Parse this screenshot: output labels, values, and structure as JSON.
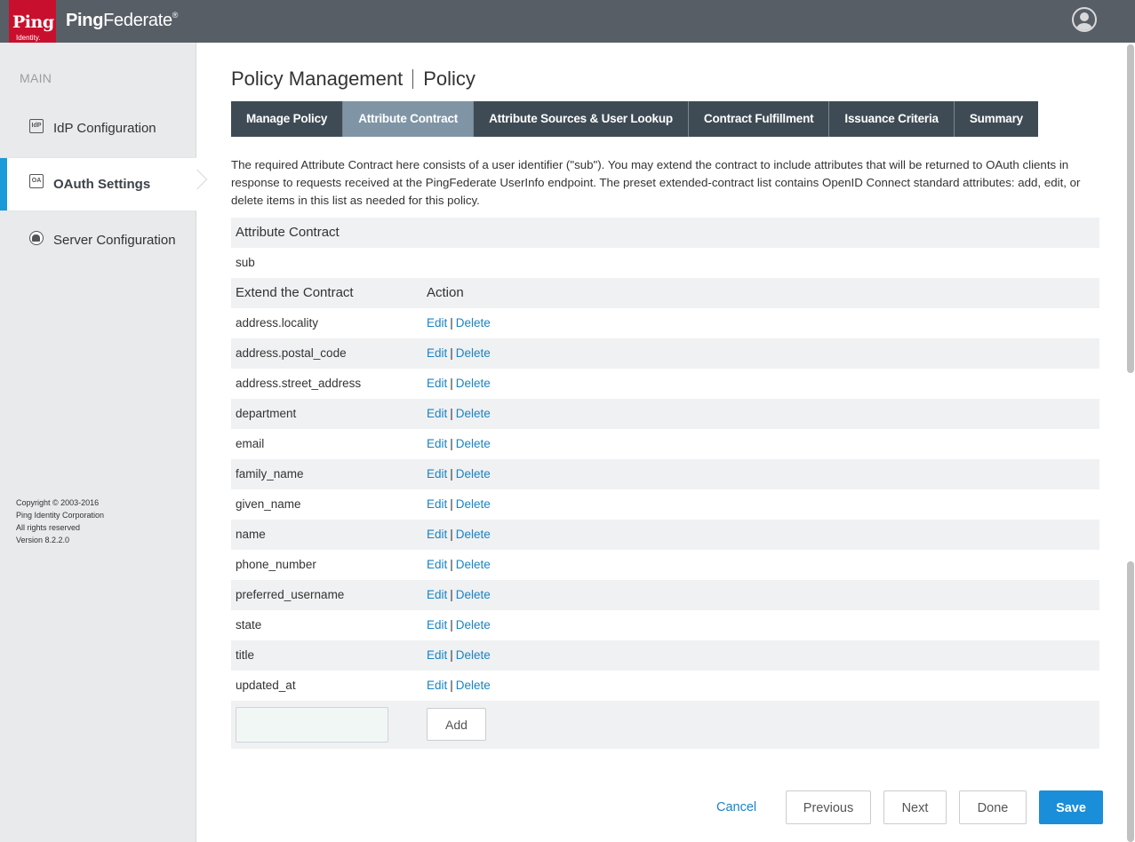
{
  "header": {
    "logo_text": "Ping",
    "logo_subtext": "Identity.",
    "product_name_bold": "Ping",
    "product_name_rest": "Federate",
    "trademark": "®"
  },
  "sidebar": {
    "section_label": "MAIN",
    "items": [
      {
        "label": "IdP Configuration",
        "icon": "idp-icon",
        "icon_text": "IdP"
      },
      {
        "label": "OAuth Settings",
        "icon": "oa-icon",
        "icon_text": "OA"
      },
      {
        "label": "Server Configuration",
        "icon": "server-icon",
        "icon_text": ""
      }
    ],
    "copyright": [
      "Copyright © 2003-2016",
      "Ping Identity Corporation",
      "All rights reserved",
      "Version 8.2.2.0"
    ]
  },
  "page": {
    "title_main": "Policy Management",
    "title_sub": "Policy"
  },
  "tabs": [
    {
      "label": "Manage Policy"
    },
    {
      "label": "Attribute Contract"
    },
    {
      "label": "Attribute Sources & User Lookup"
    },
    {
      "label": "Contract Fulfillment"
    },
    {
      "label": "Issuance Criteria"
    },
    {
      "label": "Summary"
    }
  ],
  "intro_text": "The required Attribute Contract here consists of a user identifier (\"sub\"). You may extend the contract to include attributes that will be returned to OAuth clients in response to requests received at the PingFederate UserInfo endpoint. The preset extended-contract list contains OpenID Connect standard attributes: add, edit, or delete items in this list as needed for this policy.",
  "contract": {
    "header": "Attribute Contract",
    "core_attribute": "sub",
    "extend_header": "Extend the Contract",
    "action_header": "Action",
    "edit_label": "Edit",
    "delete_label": "Delete",
    "separator": "|",
    "attributes": [
      "address.locality",
      "address.postal_code",
      "address.street_address",
      "department",
      "email",
      "family_name",
      "given_name",
      "name",
      "phone_number",
      "preferred_username",
      "state",
      "title",
      "updated_at"
    ],
    "new_attribute_value": "",
    "add_label": "Add"
  },
  "footer": {
    "cancel_label": "Cancel",
    "previous_label": "Previous",
    "next_label": "Next",
    "done_label": "Done",
    "save_label": "Save"
  },
  "colors": {
    "topbar": "#575e66",
    "brand_red": "#c8102e",
    "tab_dark": "#3e4b55",
    "tab_active": "#7f95a6",
    "link": "#1a83c5",
    "save": "#1a8ed8"
  }
}
